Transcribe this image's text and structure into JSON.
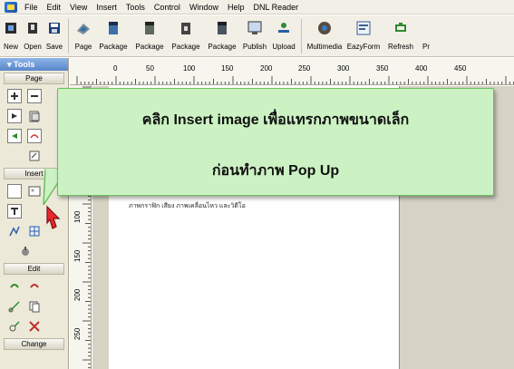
{
  "menu": [
    "File",
    "Edit",
    "View",
    "Insert",
    "Tools",
    "Control",
    "Window",
    "Help",
    "DNL Reader"
  ],
  "toolbar": [
    {
      "label": "New",
      "icon": "new-icon"
    },
    {
      "label": "Open",
      "icon": "open-icon"
    },
    {
      "label": "Save",
      "icon": "save-icon"
    },
    {
      "label": "Page",
      "icon": "page-icon"
    },
    {
      "label": "Package",
      "icon": "package-icon"
    },
    {
      "label": "Package",
      "icon": "package-icon"
    },
    {
      "label": "Package",
      "icon": "package-icon"
    },
    {
      "label": "Package",
      "icon": "package-icon"
    },
    {
      "label": "Publish",
      "icon": "publish-icon"
    },
    {
      "label": "Upload",
      "icon": "upload-icon"
    },
    {
      "label": "Multimedia",
      "icon": "multimedia-icon"
    },
    {
      "label": "EazyForm",
      "icon": "eazyform-icon"
    },
    {
      "label": "Refresh",
      "icon": "refresh-icon"
    },
    {
      "label": "Pr",
      "icon": "preview-icon"
    }
  ],
  "tools_panel": {
    "title": "Tools",
    "sections": {
      "page": "Page",
      "insert": "Insert",
      "edit": "Edit",
      "change": "Change"
    }
  },
  "ruler_top": [
    "0",
    "50",
    "100",
    "150",
    "200",
    "250",
    "300",
    "350",
    "400",
    "450"
  ],
  "ruler_left": [
    "100",
    "150",
    "200",
    "250"
  ],
  "page_text": "ภาพกราฟิก เสียง ภาพเคลื่อนไหว และวิดีโอ",
  "callout": {
    "line1": "คลิก Insert image เพื่อแทรกภาพขนาดเล็ก",
    "line2": "ก่อนทำภาพ Pop Up"
  },
  "colors": {
    "callout_bg": "#ccf2c4",
    "callout_border": "#6abf5e",
    "cursor": "#e8282f"
  }
}
